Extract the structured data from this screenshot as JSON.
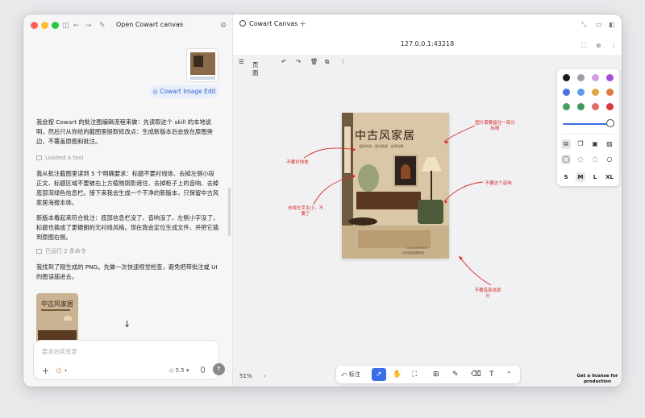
{
  "left_panel": {
    "window_title": "Open Cowart canvas",
    "title_more": "···",
    "chip_label": "Cowart Image Edit",
    "para1": "我会按 Cowart 的批注图编辑流程来做：先读取这个 skill 的本地说明，然后只从你给的截图里提取修改点：生成新版本后会放在原图旁边，不覆盖原图和批注。",
    "meta1": "Loaded a tool",
    "para2": "我从批注截图里读到 5 个明确要求：标题不要衬线体、去掉左侧小段正文、标题区域不要被右上方植物阴影遮住、去掉柜子上的音响、去掉底部深绿色信息栏。接下来我会生成一个干净的新版本，只保留中古风家居海报本体。",
    "para3": "新版本看起来符合批注：底部信息栏没了、音响没了、左侧小字没了，标题也换成了更硬朗的无衬线风格。现在我会定位生成文件，并把它插到原图右侧。",
    "meta2": "已运行 2 条命令",
    "para4": "我找到了刚生成的 PNG。先做一次快速视觉检查，避免把带批注或 UI 的图误插进去。",
    "result_thumb_title": "中古风家居",
    "composer_placeholder": "要求后续变更",
    "model_label": "5.5"
  },
  "right_panel": {
    "tab_label": "Cowart Canvas",
    "url": "127.0.0.1:43218",
    "toolbar_page_label": "页面",
    "poster": {
      "title": "中古风家居",
      "subtitle": "温润木质 · 复古格调 · 自然光影",
      "footer1": "CASA VINTAGE",
      "footer2": "让家回到温暖质感"
    },
    "annotations": {
      "note_top_right": "图片需要留住一部分标题",
      "note_left_top": "不要衬线体",
      "note_right_mid": "不要这个音响",
      "note_left_low": "去掉左字太小，不要了",
      "note_bottom": "不要底部这部分"
    },
    "palette": {
      "colors": [
        "#1a1a1a",
        "#9aa0aa",
        "#d49ee6",
        "#a34fd6",
        "#4a72e0",
        "#5aa0e8",
        "#e0a642",
        "#e07a38",
        "#4aa05a",
        "#3f9a5a",
        "#e06a6a",
        "#d63a3a"
      ],
      "sizes": [
        "S",
        "M",
        "L",
        "XL"
      ],
      "selected_size": "M"
    },
    "bottom_toolbar": {
      "annotate_label": "标注"
    },
    "zoom_level": "51%",
    "license_text": "Get a license for production"
  }
}
